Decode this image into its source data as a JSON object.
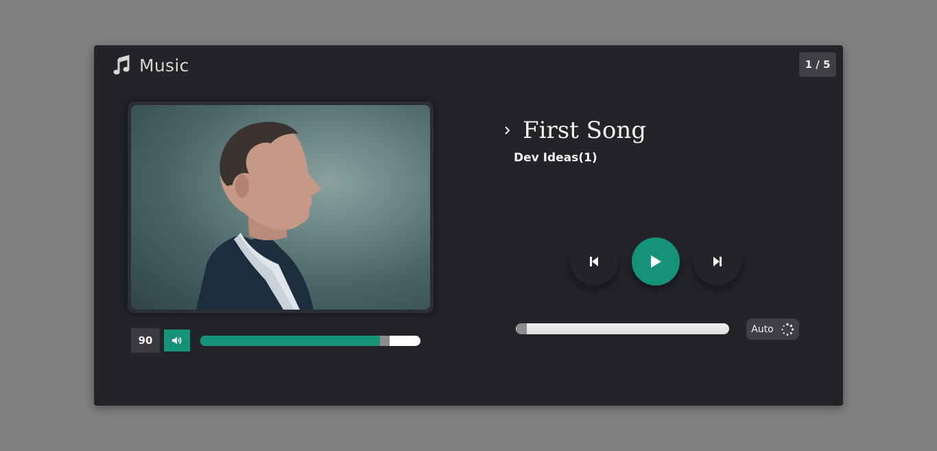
{
  "header": {
    "title": "Music",
    "icon": "music-note-icon"
  },
  "counter": {
    "text": "1 / 5"
  },
  "track": {
    "title": "First Song",
    "artist": "Dev Ideas(1)",
    "progress": 0.05
  },
  "volume": {
    "value": "90",
    "level": 0.86,
    "icon": "speaker-icon"
  },
  "controls": {
    "prev_icon": "skip-previous-icon",
    "play_icon": "play-icon",
    "next_icon": "skip-next-icon"
  },
  "mode": {
    "label": "Auto",
    "icon": "loading-dots-icon"
  },
  "colors": {
    "accent": "#14937a",
    "panel": "#232428",
    "page": "#808080"
  }
}
